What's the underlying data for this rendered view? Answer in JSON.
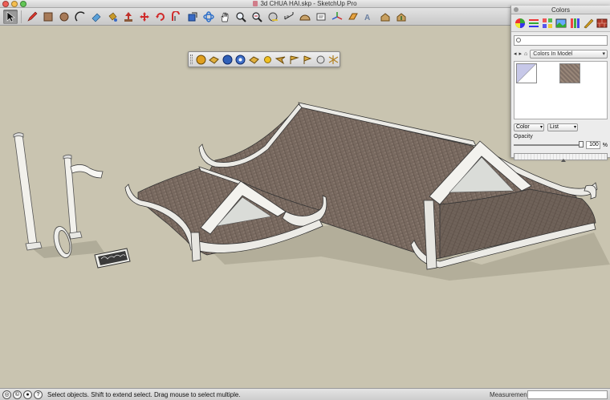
{
  "window": {
    "title": "3d CHUA HAI.skp - SketchUp Pro"
  },
  "toolbar": {
    "tools": [
      "select-tool",
      "pencil-tool",
      "rectangle-tool",
      "circle-tool",
      "arc-tool",
      "eraser-tool",
      "paint-bucket-tool",
      "push-pull-tool",
      "move-tool",
      "rotate-tool",
      "offset-tool",
      "scale-tool",
      "orbit-tool",
      "pan-tool",
      "zoom-tool",
      "zoom-extents-tool",
      "tape-measure-tool",
      "dimension-tool",
      "protractor-tool",
      "text-tool",
      "axes-tool",
      "section-plane-tool",
      "3d-text-tool",
      "get-models-tool",
      "share-model-tool"
    ]
  },
  "floating_toolbar": {
    "tools": [
      "sandbox-from-contours",
      "sandbox-from-scratch",
      "smoove-tool",
      "stamp-tool",
      "drape-tool",
      "add-detail-tool",
      "flip-edge-tool",
      "sun-icon",
      "eye-icon",
      "flag-icon",
      "sphere-icon",
      "grid-icon"
    ]
  },
  "colors_panel": {
    "title": "Colors",
    "search_placeholder": "",
    "library": "Colors In Model",
    "color_mode": "Color",
    "view_mode": "List",
    "opacity_label": "Opacity",
    "opacity_value": "100",
    "opacity_unit": "%",
    "opacity_fraction": 1.0
  },
  "statusbar": {
    "message": "Select objects. Shift to extend select. Drag mouse to select multiple.",
    "measurements_label": "Measurements",
    "measurements_value": ""
  },
  "colors": {
    "background": "#c9c4b0",
    "roof_tile": "#77695f",
    "trim": "#e8e6df"
  }
}
